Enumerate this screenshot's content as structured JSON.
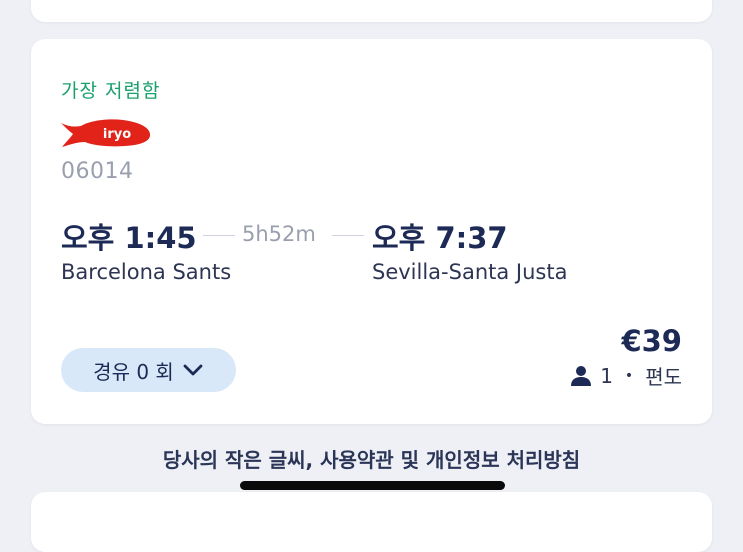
{
  "result": {
    "badge": "가장 저렴함",
    "operator_logo_text": "iryo",
    "train_number": "06014",
    "departure": {
      "time": "오후 1:45",
      "station": "Barcelona Sants"
    },
    "duration": "5h52m",
    "arrival": {
      "time": "오후 7:37",
      "station": "Sevilla-Santa Justa"
    },
    "stops_label": "경유 0 회",
    "price": "€39",
    "passengers": "1",
    "trip_type": "편도"
  },
  "footer": {
    "links_text": "당사의 작은 글씨, 사용약관 및 개인정보 처리방침"
  },
  "colors": {
    "accent_green": "#1aa06d",
    "navy": "#1c2a55",
    "iryo_red": "#e2231a",
    "stops_bg": "#d9e8f8"
  },
  "icons": [
    "iryo-logo-icon",
    "chevron-down-icon",
    "person-icon"
  ]
}
